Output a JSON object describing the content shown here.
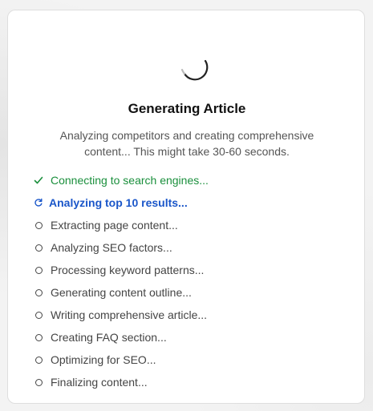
{
  "dialog": {
    "title": "Generating Article",
    "description": "Analyzing competitors and creating comprehensive content... This might take 30-60 seconds."
  },
  "colors": {
    "done": "#1a8f3c",
    "active": "#1a56c9",
    "pending": "#444444"
  },
  "steps": [
    {
      "label": "Connecting to search engines...",
      "status": "done",
      "icon": "checkmark-icon"
    },
    {
      "label": "Analyzing top 10 results...",
      "status": "active",
      "icon": "refresh-icon"
    },
    {
      "label": "Extracting page content...",
      "status": "pending",
      "icon": "circle-icon"
    },
    {
      "label": "Analyzing SEO factors...",
      "status": "pending",
      "icon": "circle-icon"
    },
    {
      "label": "Processing keyword patterns...",
      "status": "pending",
      "icon": "circle-icon"
    },
    {
      "label": "Generating content outline...",
      "status": "pending",
      "icon": "circle-icon"
    },
    {
      "label": "Writing comprehensive article...",
      "status": "pending",
      "icon": "circle-icon"
    },
    {
      "label": "Creating FAQ section...",
      "status": "pending",
      "icon": "circle-icon"
    },
    {
      "label": "Optimizing for SEO...",
      "status": "pending",
      "icon": "circle-icon"
    },
    {
      "label": "Finalizing content...",
      "status": "pending",
      "icon": "circle-icon"
    }
  ]
}
